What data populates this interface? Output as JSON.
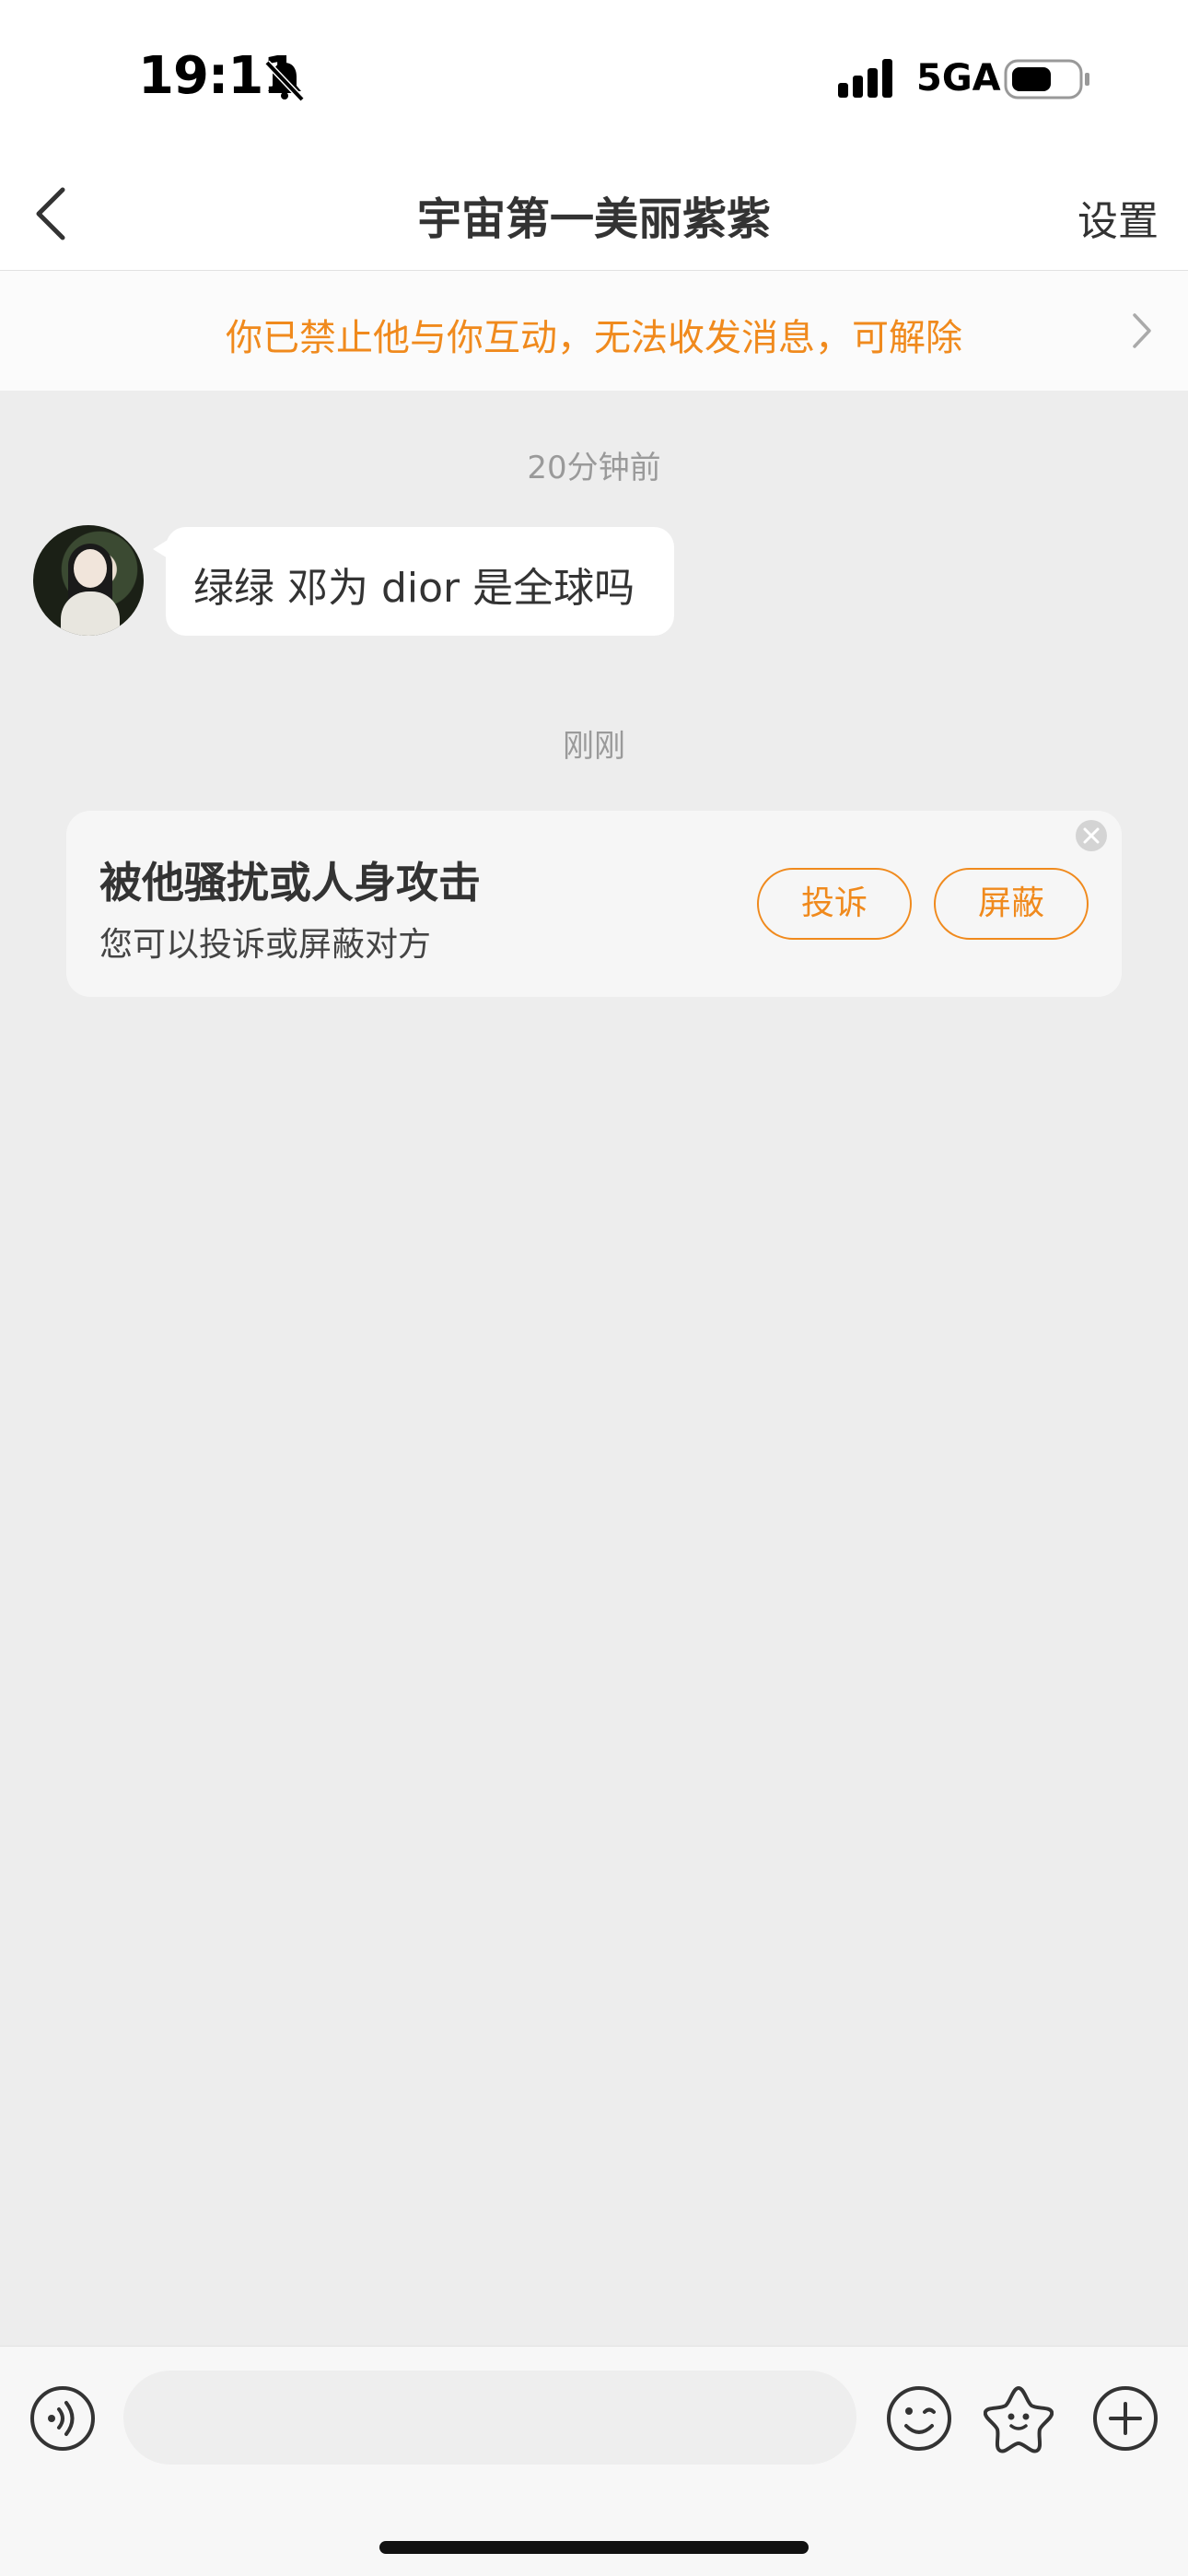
{
  "status_bar": {
    "time": "19:11",
    "network": "5GA"
  },
  "header": {
    "title": "宇宙第一美丽紫紫",
    "settings_label": "设置"
  },
  "notice": {
    "text": "你已禁止他与你互动，无法收发消息，可解除"
  },
  "conversation": {
    "timestamps": [
      "20分钟前",
      "刚刚"
    ],
    "messages": [
      {
        "text": "绿绿 邓为 dior 是全球吗"
      }
    ]
  },
  "report_card": {
    "title": "被他骚扰或人身攻击",
    "subtitle": "您可以投诉或屏蔽对方",
    "report_label": "投诉",
    "block_label": "屏蔽"
  },
  "composer": {
    "placeholder": ""
  },
  "colors": {
    "accent": "#f08a1d",
    "background": "#ededed",
    "bubble": "#ffffff"
  },
  "icons": [
    "bell-muted-icon",
    "signal-icon",
    "battery-icon",
    "back-icon",
    "chevron-right-icon",
    "close-icon",
    "voice-icon",
    "emoji-icon",
    "sticker-icon",
    "plus-icon"
  ]
}
